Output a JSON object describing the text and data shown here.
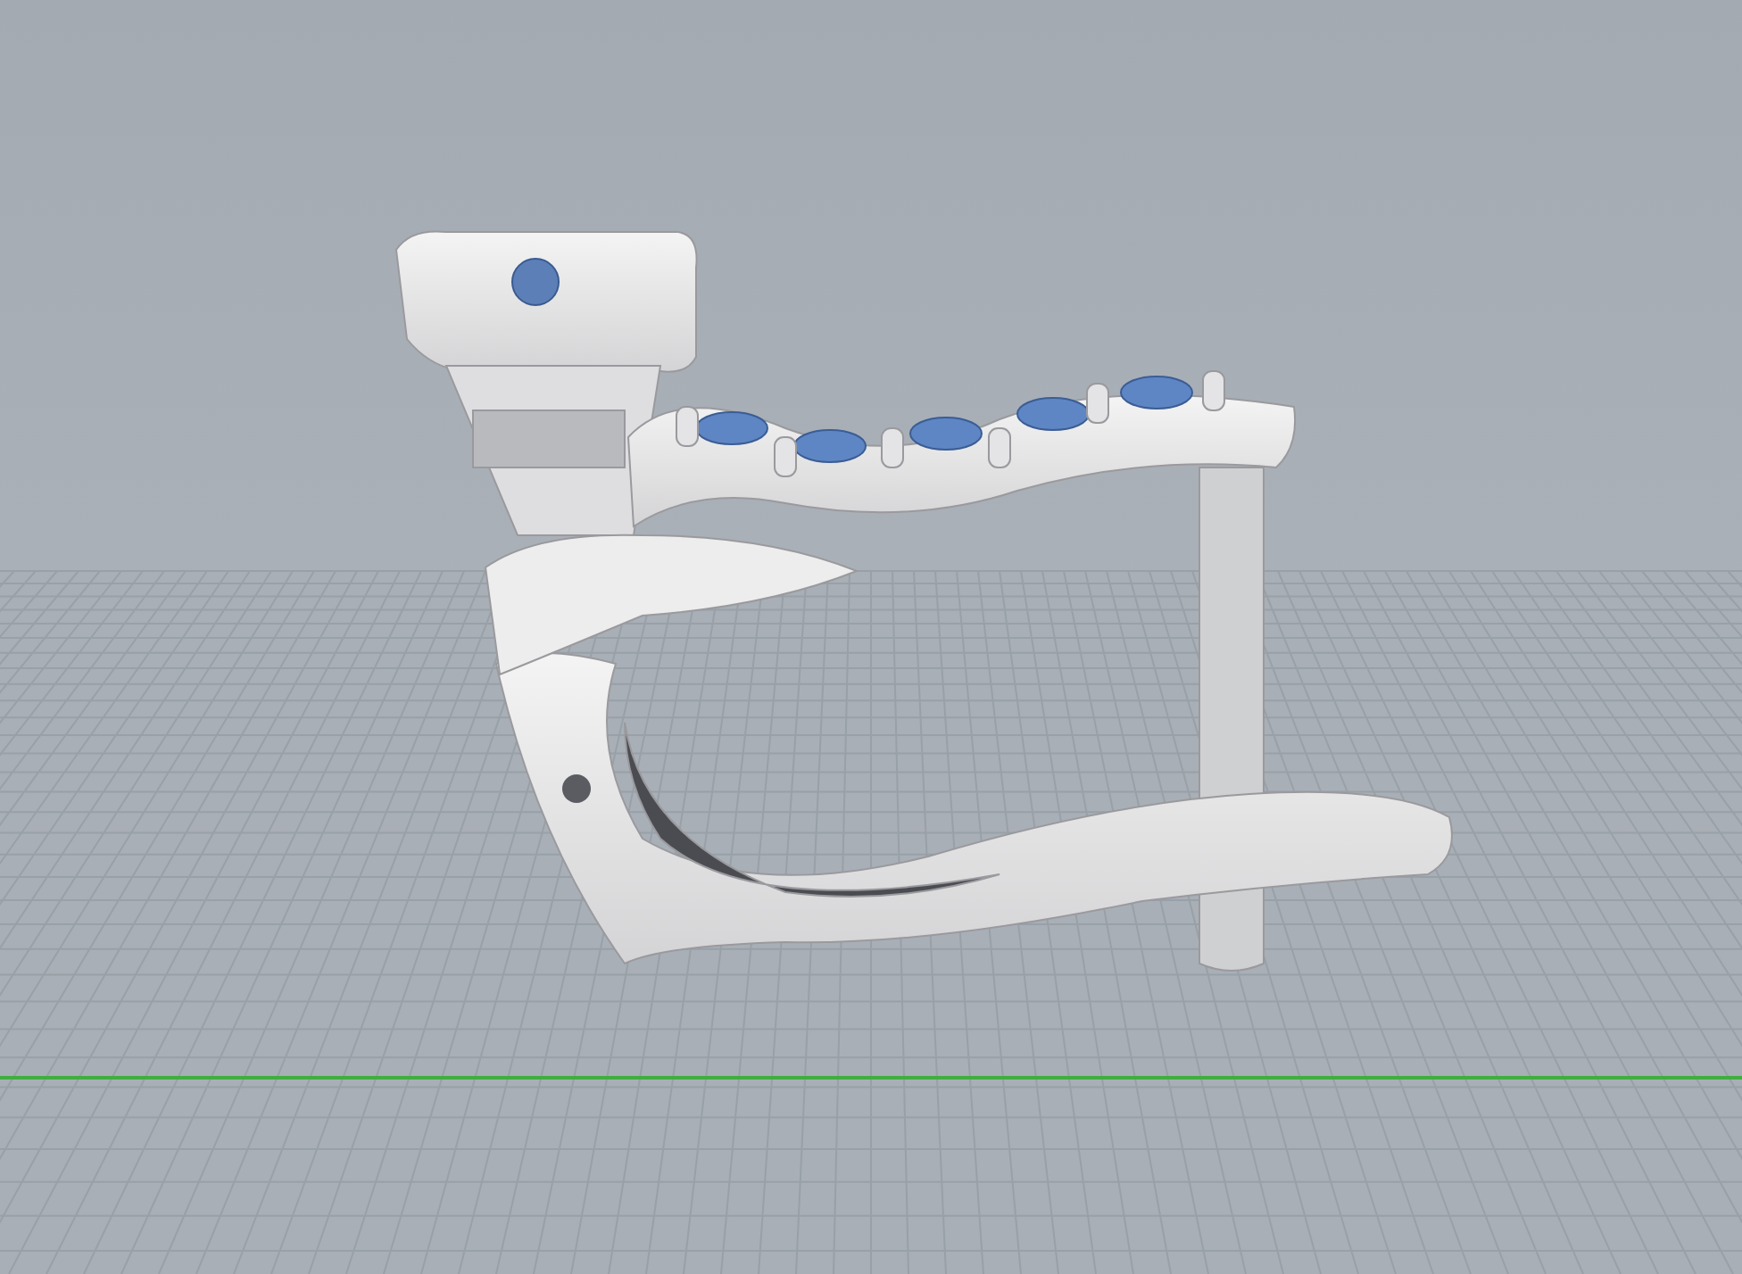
{
  "viewport": {
    "kind": "perspective",
    "grid_visible": true,
    "axis_visible": true
  }
}
